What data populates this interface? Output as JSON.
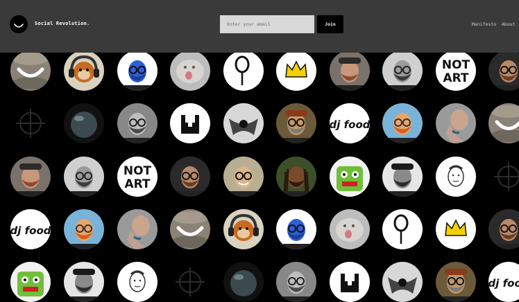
{
  "header": {
    "brand": "Social Revolution.",
    "email_placeholder": "Enter your email",
    "join_label": "Join",
    "nav": {
      "manifesto": "Manifesto",
      "about": "About"
    }
  },
  "colors": {
    "header_bg": "#3a3a3a",
    "page_bg": "#000000",
    "input_bg": "#d9d9d9",
    "crown_yellow": "#f4d000"
  },
  "avatar_grid": {
    "rows": [
      [
        "smile-stones",
        "monkey-headphones",
        "blue-glasses-man",
        "blurred-dog",
        "spoon-drawing",
        "yellow-crown",
        "bearded-man-hat",
        "bw-bearded-man",
        "not-art",
        "bearded-man-partial"
      ],
      [
        "crosshair",
        "sphere-dark",
        "bw-older-man",
        "m-logo",
        "bw-symmetric",
        "glasses-man-hat",
        "dj-food",
        "ginger-illustration",
        "tattoo-neck",
        "smile-stones"
      ],
      [
        "bearded-man-hat",
        "bw-bearded-man",
        "not-art",
        "bearded-man-partial",
        "smiling-man",
        "dreadlocks-man",
        "green-monster",
        "bw-cap-man",
        "sketch-man",
        "crosshair"
      ],
      [
        "dj-food",
        "ginger-illustration",
        "tattoo-neck",
        "smile-stones",
        "monkey-headphones",
        "blue-glasses-man",
        "blurred-dog",
        "spoon-drawing",
        "yellow-crown",
        "bearded-man-partial"
      ],
      [
        "green-monster",
        "bw-cap-man",
        "sketch-man",
        "crosshair",
        "sphere-dark",
        "bw-older-man",
        "m-logo",
        "bw-symmetric",
        "glasses-man-hat",
        "dj-food"
      ]
    ],
    "labels": {
      "not_art_line1": "NOT",
      "not_art_line2": "ART",
      "dj_food": "dj food"
    }
  }
}
